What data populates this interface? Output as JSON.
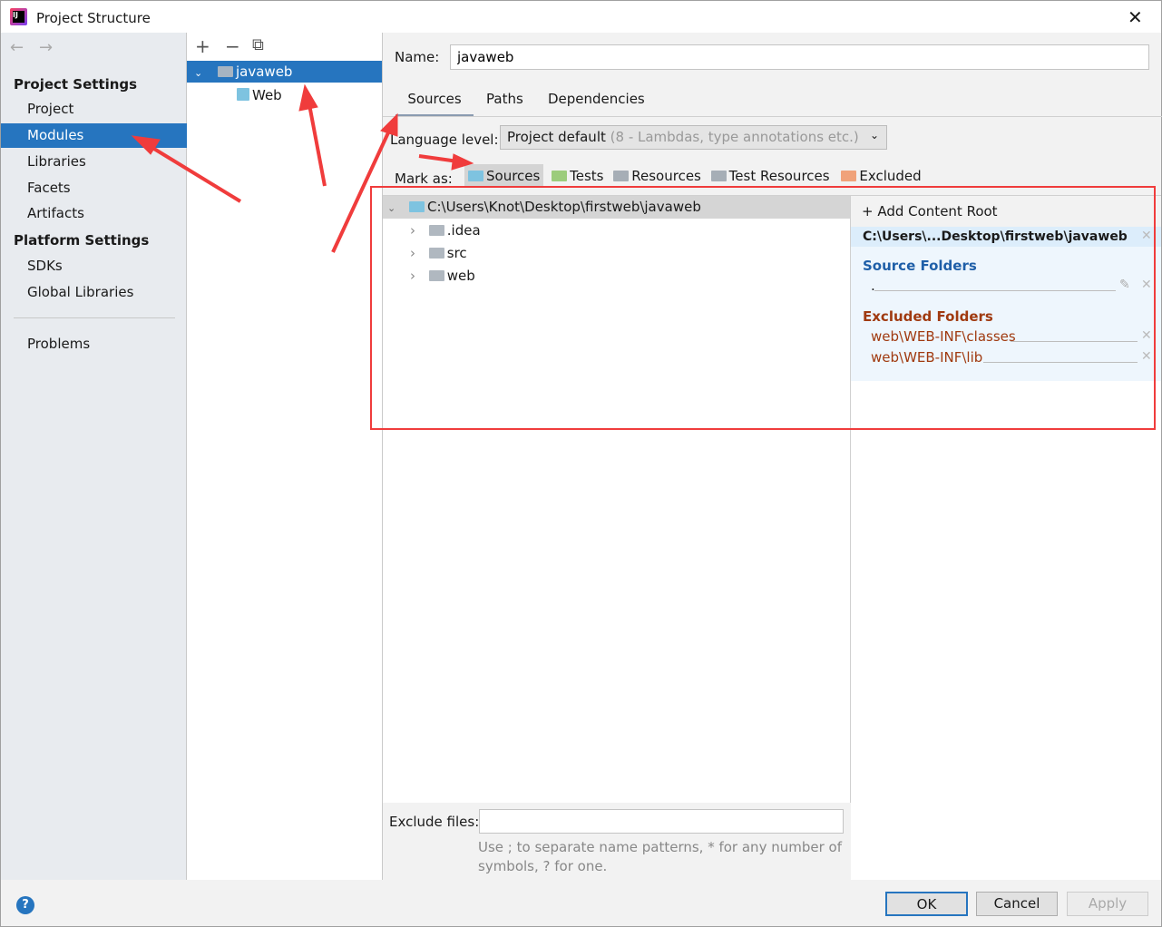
{
  "window": {
    "title": "Project Structure"
  },
  "nav": {
    "back": "←",
    "forward": "→"
  },
  "sidebar": {
    "project_settings": "Project Settings",
    "items1": [
      "Project",
      "Modules",
      "Libraries",
      "Facets",
      "Artifacts"
    ],
    "platform_settings": "Platform Settings",
    "items2": [
      "SDKs",
      "Global Libraries"
    ],
    "problems": "Problems",
    "selected": "Modules"
  },
  "module_tree": {
    "toolbar": [
      "+",
      "−",
      "⧉"
    ],
    "root": "javaweb",
    "child": "Web"
  },
  "name_field": {
    "label": "Name:",
    "value": "javaweb"
  },
  "tabs": [
    "Sources",
    "Paths",
    "Dependencies"
  ],
  "active_tab": "Sources",
  "language_level": {
    "label": "Language level:",
    "value": "Project default",
    "hint": "(8 - Lambdas, type annotations etc.)"
  },
  "mark_as": {
    "label": "Mark as:",
    "buttons": [
      {
        "label": "Sources",
        "color": "#7ec3e0"
      },
      {
        "label": "Tests",
        "color": "#9ccc7c"
      },
      {
        "label": "Resources",
        "color": "#a6aeb6"
      },
      {
        "label": "Test Resources",
        "color": "#a6aeb6"
      },
      {
        "label": "Excluded",
        "color": "#f0a27a"
      }
    ]
  },
  "file_tree": {
    "root": "C:\\Users\\Knot\\Desktop\\firstweb\\javaweb",
    "children": [
      ".idea",
      "src",
      "web"
    ]
  },
  "content_root": {
    "add_label": "Add Content Root",
    "path": "C:\\Users\\...Desktop\\firstweb\\javaweb",
    "source_title": "Source Folders",
    "source_items": [
      "."
    ],
    "excluded_title": "Excluded Folders",
    "excluded_items": [
      "web\\WEB-INF\\classes",
      "web\\WEB-INF\\lib"
    ]
  },
  "exclude_files": {
    "label": "Exclude files:",
    "value": "",
    "hint_line1": "Use ; to separate name patterns, * for any number of",
    "hint_line2": "symbols, ? for one."
  },
  "footer": {
    "help": "?",
    "ok": "OK",
    "cancel": "Cancel",
    "apply": "Apply"
  },
  "colors": {
    "accent": "#2675bf",
    "annotation": "#f03c3c",
    "source_title": "#1f5fa8",
    "excluded_title": "#a03a10"
  }
}
